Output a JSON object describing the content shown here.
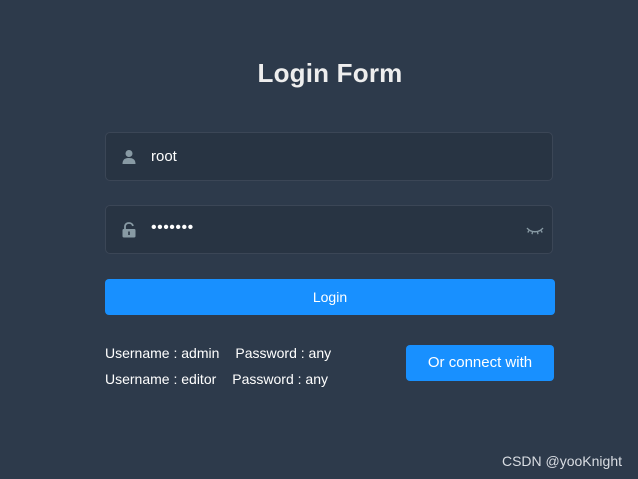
{
  "form": {
    "title": "Login Form",
    "username_value": "root",
    "password_value": "•••••••",
    "login_label": "Login"
  },
  "icons": {
    "username": "user-icon",
    "password": "lock-icon",
    "toggle": "eye-closed-icon"
  },
  "tips": [
    {
      "username": "Username : admin",
      "password": "Password : any"
    },
    {
      "username": "Username : editor",
      "password": "Password : any"
    }
  ],
  "connect_label": "Or connect with",
  "watermark": "CSDN @yooKnight",
  "colors": {
    "background": "#2d3a4b",
    "input_background": "#283443",
    "accent": "#1890ff"
  }
}
